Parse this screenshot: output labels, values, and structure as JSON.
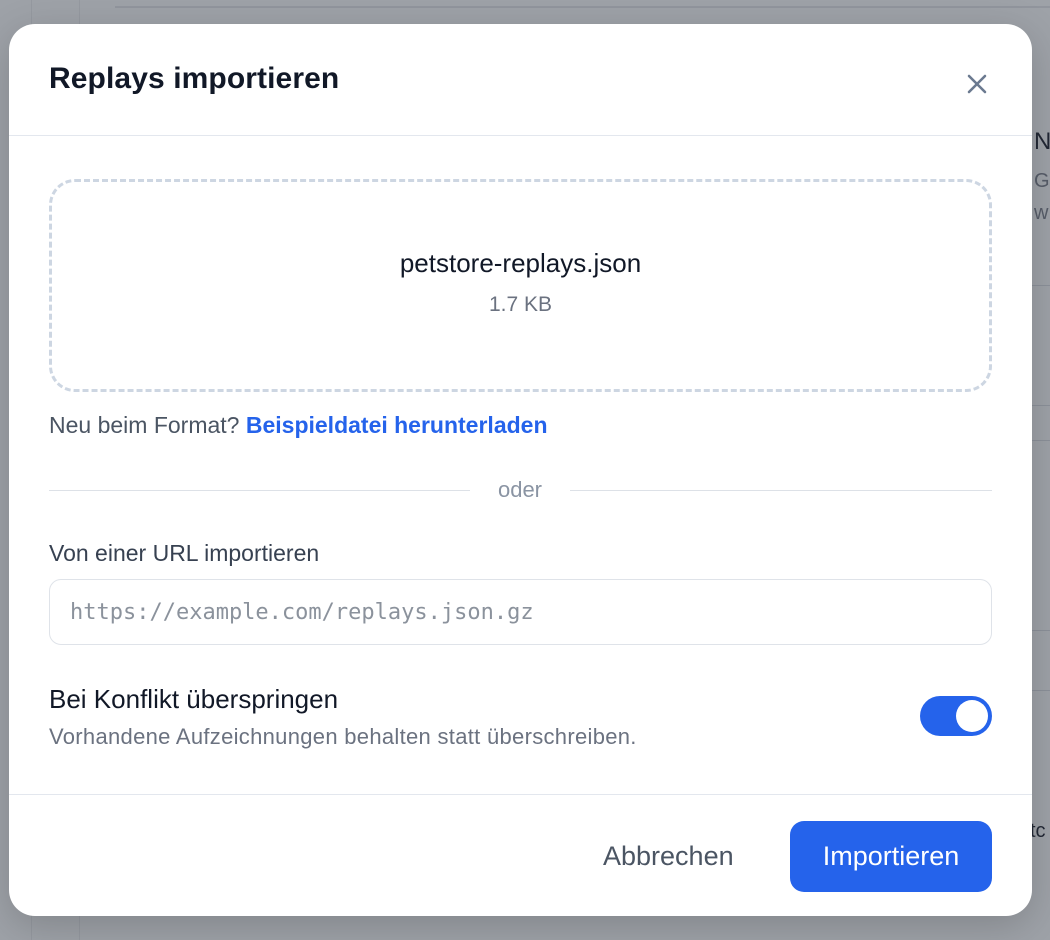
{
  "background": {
    "peek_title": "N",
    "peek_line1": "G",
    "peek_line2": "w",
    "peek_footer": "tc"
  },
  "dialog": {
    "title": "Replays importieren",
    "close_icon": "close-icon",
    "dropzone": {
      "file_name": "petstore-replays.json",
      "file_size": "1.7 KB"
    },
    "hint": {
      "prefix": "Neu beim Format?",
      "link": "Beispieldatei herunterladen"
    },
    "divider_text": "oder",
    "url": {
      "label": "Von einer URL importieren",
      "value": "",
      "placeholder": "https://example.com/replays.json.gz"
    },
    "skip_on_conflict": {
      "title": "Bei Konflikt überspringen",
      "description": "Vorhandene Aufzeichnungen behalten statt überschreiben.",
      "enabled": true
    },
    "footer": {
      "cancel_label": "Abbrechen",
      "import_label": "Importieren"
    }
  },
  "colors": {
    "accent": "#2563eb",
    "title_text": "#111827",
    "muted_text": "#6b7280",
    "border": "#e3e7ee"
  }
}
